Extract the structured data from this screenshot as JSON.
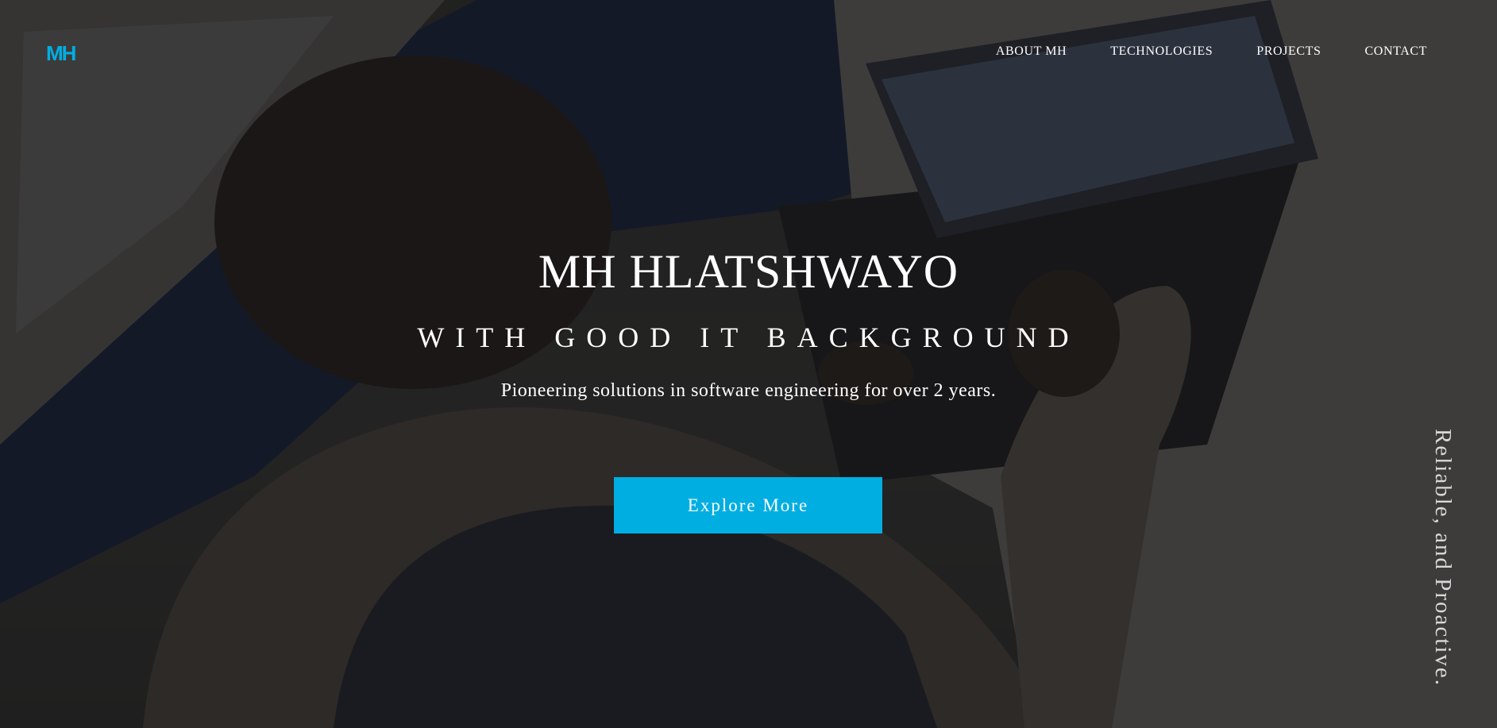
{
  "brand": {
    "logo_text": "MH",
    "accent_color": "#00aee2"
  },
  "nav": {
    "items": [
      {
        "label": "ABOUT MH"
      },
      {
        "label": "TECHNOLOGIES"
      },
      {
        "label": "PROJECTS"
      },
      {
        "label": "CONTACT"
      }
    ]
  },
  "hero": {
    "title": "MH HLATSHWAYO",
    "subtitle": "WITH GOOD IT BACKGROUND",
    "tagline": "Pioneering solutions in software engineering for over 2 years.",
    "cta_label": "Explore More",
    "side_text": "Reliable, and Proactive."
  }
}
